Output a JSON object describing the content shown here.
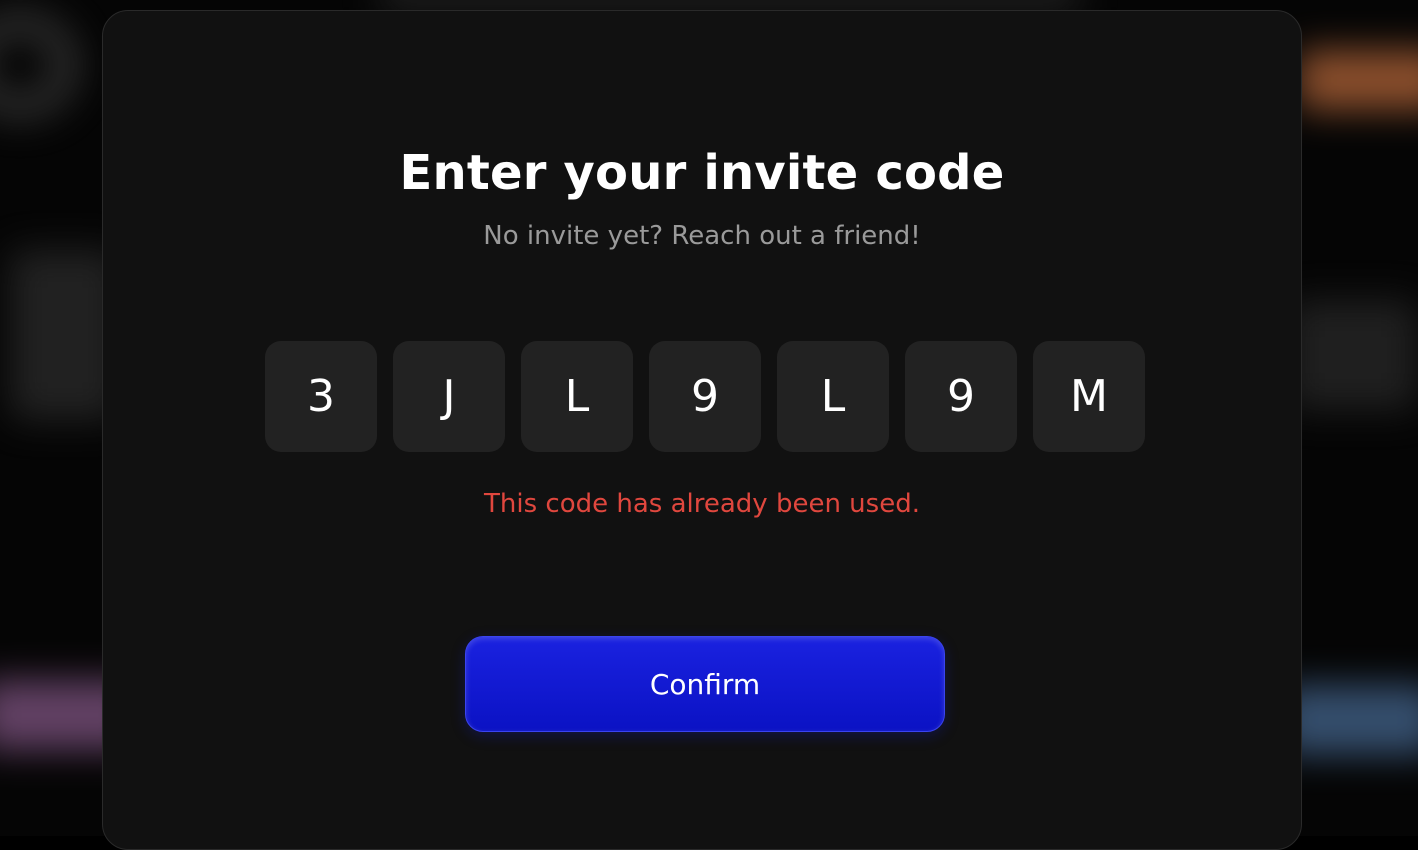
{
  "modal": {
    "title": "Enter your invite code",
    "subtitle": "No invite yet? Reach out a friend!",
    "code_chars": [
      "3",
      "J",
      "L",
      "9",
      "L",
      "9",
      "M"
    ],
    "error_message": "This code has already been used.",
    "confirm_label": "Confirm"
  },
  "colors": {
    "background": "#111111",
    "code_box": "#222222",
    "error": "#e0473e",
    "accent": "#0b12c4"
  }
}
